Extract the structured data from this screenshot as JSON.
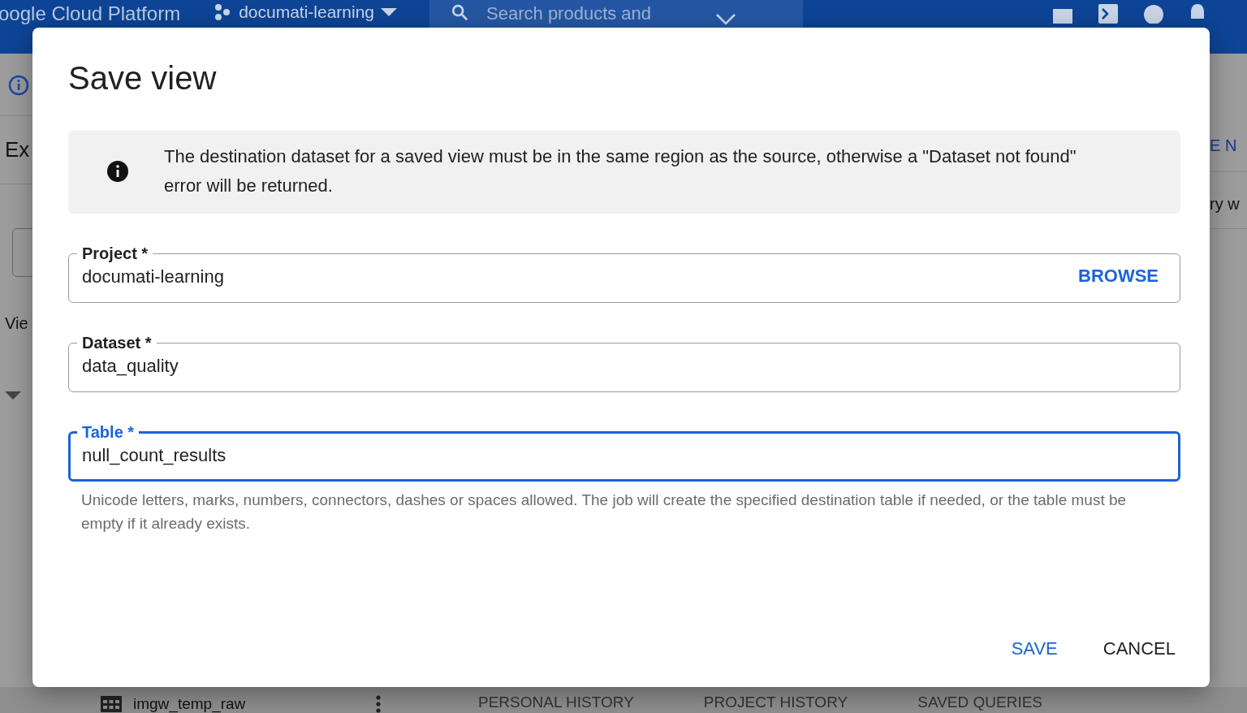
{
  "console": {
    "brand": "oogle Cloud Platform",
    "project": "documati-learning",
    "search_placeholder": "Search products and",
    "left_panel": {
      "heading": "Ex",
      "label": "Vie"
    },
    "right_panel": {
      "action": "E N",
      "text": "ry w"
    },
    "bottom": {
      "table_name": "imgw_temp_raw",
      "tabs": [
        {
          "label": "PERSONAL HISTORY",
          "selected": false
        },
        {
          "label": "PROJECT HISTORY",
          "selected": false
        },
        {
          "label": "SAVED QUERIES",
          "selected": false
        }
      ]
    }
  },
  "dialog": {
    "title": "Save view",
    "notice": "The destination dataset for a saved view must be in the same region as the source, otherwise a \"Dataset not found\" error will be returned.",
    "fields": [
      {
        "label": "Project *",
        "value": "documati-learning",
        "action": "BROWSE",
        "focused": false
      },
      {
        "label": "Dataset *",
        "value": "data_quality",
        "focused": false
      },
      {
        "label": "Table *",
        "value": "null_count_results",
        "focused": true
      }
    ],
    "hint": "Unicode letters, marks, numbers, connectors, dashes or spaces allowed. The job will create the specified destination table if needed, or the table must be empty if it already exists.",
    "buttons": [
      {
        "label": "SAVE",
        "primary": true
      },
      {
        "label": "CANCEL",
        "primary": false
      }
    ]
  }
}
